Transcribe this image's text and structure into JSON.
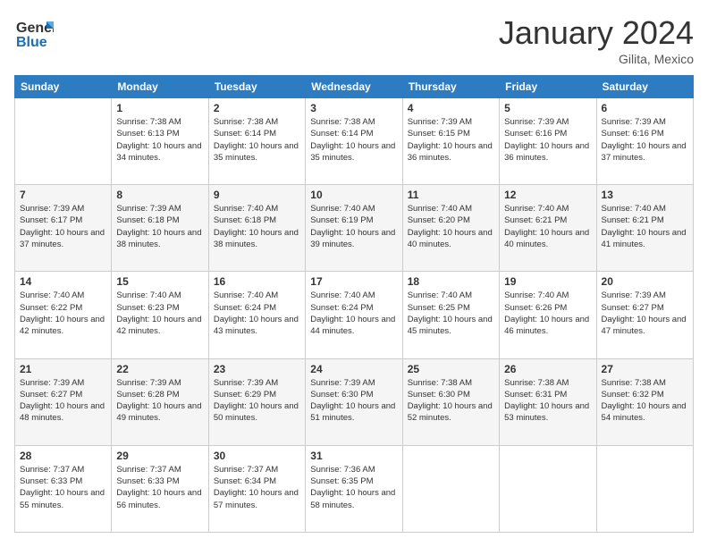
{
  "logo": {
    "line1": "General",
    "line2": "Blue"
  },
  "header": {
    "month": "January 2024",
    "location": "Gilita, Mexico"
  },
  "days_of_week": [
    "Sunday",
    "Monday",
    "Tuesday",
    "Wednesday",
    "Thursday",
    "Friday",
    "Saturday"
  ],
  "weeks": [
    [
      {
        "day": "",
        "sunrise": "",
        "sunset": "",
        "daylight": ""
      },
      {
        "day": "1",
        "sunrise": "Sunrise: 7:38 AM",
        "sunset": "Sunset: 6:13 PM",
        "daylight": "Daylight: 10 hours and 34 minutes."
      },
      {
        "day": "2",
        "sunrise": "Sunrise: 7:38 AM",
        "sunset": "Sunset: 6:14 PM",
        "daylight": "Daylight: 10 hours and 35 minutes."
      },
      {
        "day": "3",
        "sunrise": "Sunrise: 7:38 AM",
        "sunset": "Sunset: 6:14 PM",
        "daylight": "Daylight: 10 hours and 35 minutes."
      },
      {
        "day": "4",
        "sunrise": "Sunrise: 7:39 AM",
        "sunset": "Sunset: 6:15 PM",
        "daylight": "Daylight: 10 hours and 36 minutes."
      },
      {
        "day": "5",
        "sunrise": "Sunrise: 7:39 AM",
        "sunset": "Sunset: 6:16 PM",
        "daylight": "Daylight: 10 hours and 36 minutes."
      },
      {
        "day": "6",
        "sunrise": "Sunrise: 7:39 AM",
        "sunset": "Sunset: 6:16 PM",
        "daylight": "Daylight: 10 hours and 37 minutes."
      }
    ],
    [
      {
        "day": "7",
        "sunrise": "Sunrise: 7:39 AM",
        "sunset": "Sunset: 6:17 PM",
        "daylight": "Daylight: 10 hours and 37 minutes."
      },
      {
        "day": "8",
        "sunrise": "Sunrise: 7:39 AM",
        "sunset": "Sunset: 6:18 PM",
        "daylight": "Daylight: 10 hours and 38 minutes."
      },
      {
        "day": "9",
        "sunrise": "Sunrise: 7:40 AM",
        "sunset": "Sunset: 6:18 PM",
        "daylight": "Daylight: 10 hours and 38 minutes."
      },
      {
        "day": "10",
        "sunrise": "Sunrise: 7:40 AM",
        "sunset": "Sunset: 6:19 PM",
        "daylight": "Daylight: 10 hours and 39 minutes."
      },
      {
        "day": "11",
        "sunrise": "Sunrise: 7:40 AM",
        "sunset": "Sunset: 6:20 PM",
        "daylight": "Daylight: 10 hours and 40 minutes."
      },
      {
        "day": "12",
        "sunrise": "Sunrise: 7:40 AM",
        "sunset": "Sunset: 6:21 PM",
        "daylight": "Daylight: 10 hours and 40 minutes."
      },
      {
        "day": "13",
        "sunrise": "Sunrise: 7:40 AM",
        "sunset": "Sunset: 6:21 PM",
        "daylight": "Daylight: 10 hours and 41 minutes."
      }
    ],
    [
      {
        "day": "14",
        "sunrise": "Sunrise: 7:40 AM",
        "sunset": "Sunset: 6:22 PM",
        "daylight": "Daylight: 10 hours and 42 minutes."
      },
      {
        "day": "15",
        "sunrise": "Sunrise: 7:40 AM",
        "sunset": "Sunset: 6:23 PM",
        "daylight": "Daylight: 10 hours and 42 minutes."
      },
      {
        "day": "16",
        "sunrise": "Sunrise: 7:40 AM",
        "sunset": "Sunset: 6:24 PM",
        "daylight": "Daylight: 10 hours and 43 minutes."
      },
      {
        "day": "17",
        "sunrise": "Sunrise: 7:40 AM",
        "sunset": "Sunset: 6:24 PM",
        "daylight": "Daylight: 10 hours and 44 minutes."
      },
      {
        "day": "18",
        "sunrise": "Sunrise: 7:40 AM",
        "sunset": "Sunset: 6:25 PM",
        "daylight": "Daylight: 10 hours and 45 minutes."
      },
      {
        "day": "19",
        "sunrise": "Sunrise: 7:40 AM",
        "sunset": "Sunset: 6:26 PM",
        "daylight": "Daylight: 10 hours and 46 minutes."
      },
      {
        "day": "20",
        "sunrise": "Sunrise: 7:39 AM",
        "sunset": "Sunset: 6:27 PM",
        "daylight": "Daylight: 10 hours and 47 minutes."
      }
    ],
    [
      {
        "day": "21",
        "sunrise": "Sunrise: 7:39 AM",
        "sunset": "Sunset: 6:27 PM",
        "daylight": "Daylight: 10 hours and 48 minutes."
      },
      {
        "day": "22",
        "sunrise": "Sunrise: 7:39 AM",
        "sunset": "Sunset: 6:28 PM",
        "daylight": "Daylight: 10 hours and 49 minutes."
      },
      {
        "day": "23",
        "sunrise": "Sunrise: 7:39 AM",
        "sunset": "Sunset: 6:29 PM",
        "daylight": "Daylight: 10 hours and 50 minutes."
      },
      {
        "day": "24",
        "sunrise": "Sunrise: 7:39 AM",
        "sunset": "Sunset: 6:30 PM",
        "daylight": "Daylight: 10 hours and 51 minutes."
      },
      {
        "day": "25",
        "sunrise": "Sunrise: 7:38 AM",
        "sunset": "Sunset: 6:30 PM",
        "daylight": "Daylight: 10 hours and 52 minutes."
      },
      {
        "day": "26",
        "sunrise": "Sunrise: 7:38 AM",
        "sunset": "Sunset: 6:31 PM",
        "daylight": "Daylight: 10 hours and 53 minutes."
      },
      {
        "day": "27",
        "sunrise": "Sunrise: 7:38 AM",
        "sunset": "Sunset: 6:32 PM",
        "daylight": "Daylight: 10 hours and 54 minutes."
      }
    ],
    [
      {
        "day": "28",
        "sunrise": "Sunrise: 7:37 AM",
        "sunset": "Sunset: 6:33 PM",
        "daylight": "Daylight: 10 hours and 55 minutes."
      },
      {
        "day": "29",
        "sunrise": "Sunrise: 7:37 AM",
        "sunset": "Sunset: 6:33 PM",
        "daylight": "Daylight: 10 hours and 56 minutes."
      },
      {
        "day": "30",
        "sunrise": "Sunrise: 7:37 AM",
        "sunset": "Sunset: 6:34 PM",
        "daylight": "Daylight: 10 hours and 57 minutes."
      },
      {
        "day": "31",
        "sunrise": "Sunrise: 7:36 AM",
        "sunset": "Sunset: 6:35 PM",
        "daylight": "Daylight: 10 hours and 58 minutes."
      },
      {
        "day": "",
        "sunrise": "",
        "sunset": "",
        "daylight": ""
      },
      {
        "day": "",
        "sunrise": "",
        "sunset": "",
        "daylight": ""
      },
      {
        "day": "",
        "sunrise": "",
        "sunset": "",
        "daylight": ""
      }
    ]
  ]
}
